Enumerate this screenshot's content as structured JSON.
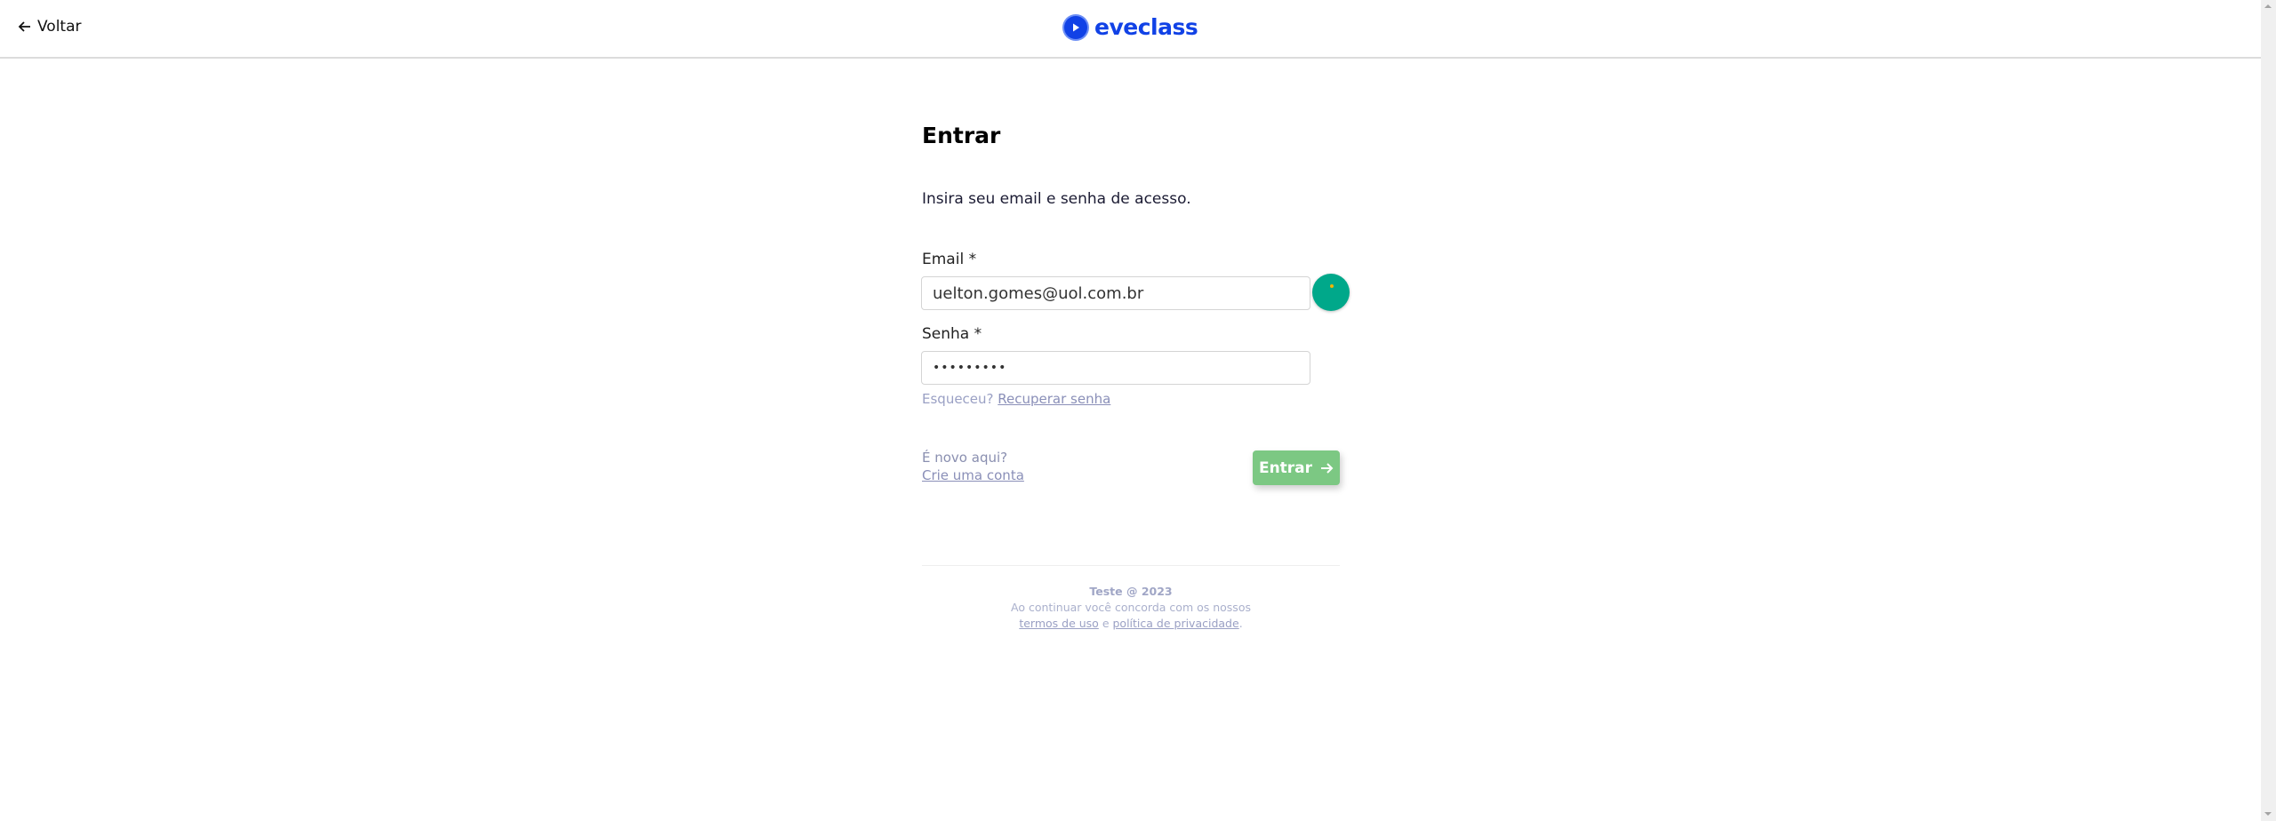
{
  "header": {
    "back_label": "Voltar",
    "logo_text": "eveclass",
    "brand_color": "#1142e6"
  },
  "form": {
    "title": "Entrar",
    "subtitle": "Insira seu email e senha de acesso.",
    "email_label": "Email *",
    "email_value": "uelton.gomes@uol.com.br",
    "password_label": "Senha *",
    "password_value": "•••••••••",
    "forgot_prefix": "Esqueceu?",
    "forgot_link": "Recuperar senha",
    "new_here": "É novo aqui?",
    "create_account": "Crie uma conta",
    "submit_label": "Entrar",
    "submit_color": "#7cc883"
  },
  "footer": {
    "copyright": "Teste @ 2023",
    "agree_text": "Ao continuar você concorda com os nossos",
    "terms_link": "termos de uso",
    "and": "e",
    "privacy_link": "política de privacidade",
    "period": "."
  }
}
